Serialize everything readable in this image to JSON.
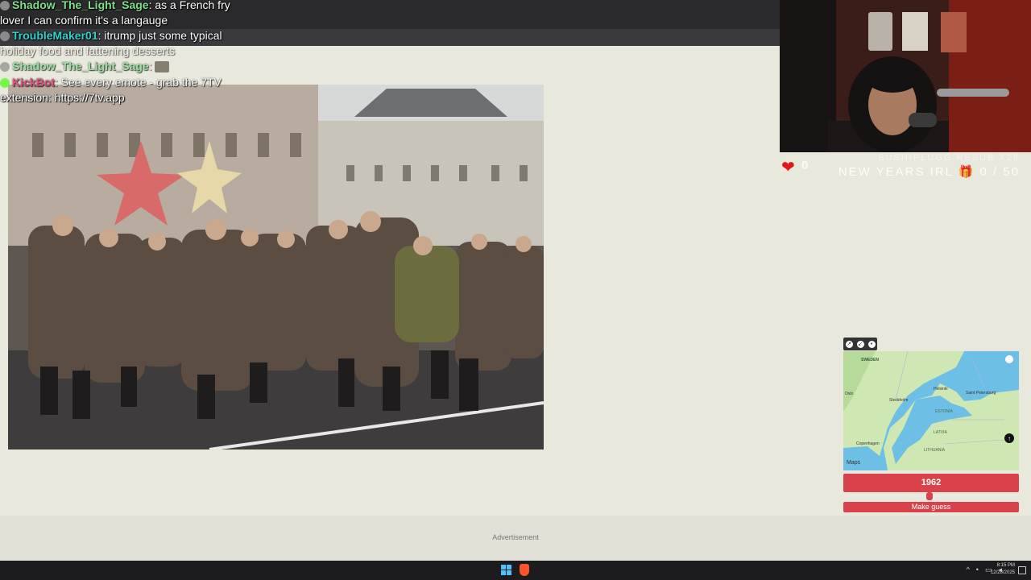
{
  "chat": [
    {
      "name": "Shadow_The_Light_Sage",
      "name_color": "#7ee08a",
      "message": ": as a French fry"
    },
    {
      "name": "",
      "name_color": "#fff",
      "message": "lover I can confirm it's a langauge"
    },
    {
      "name": "TroubleMaker01",
      "name_color": "#2fd0d0",
      "message": ": itrump just some typical"
    },
    {
      "name": "",
      "name_color": "#fff",
      "message": "holiday food and fattening desserts"
    },
    {
      "name": "Shadow_The_Light_Sage",
      "name_color": "#7ee08a",
      "message": ":"
    },
    {
      "name": "KickBot",
      "name_color": "#e0245e",
      "message": ": See every emote - grab the 7TV"
    },
    {
      "name": "",
      "name_color": "#fff",
      "message": "extension: https://7tv.app"
    }
  ],
  "stream_overlay": {
    "heart_count": "0",
    "sub_line": "SUSHIPLUGG RESUB X28",
    "goal_label": "NEW YEARS IRL",
    "goal_progress": "0 / 50"
  },
  "map": {
    "labels": {
      "sweden": "SWEDEN",
      "helsinki": "Helsinki",
      "saint_petersburg": "Saint Petersburg",
      "oslo": "Oslo",
      "stockholm": "Stockholm",
      "estonia": "ESTONIA",
      "latvia": "LATVIA",
      "copenhagen": "Copenhagen",
      "lithuania": "LITHUANIA",
      "attribution": "Maps"
    },
    "controls": [
      "expand",
      "shrink",
      "pin"
    ]
  },
  "guess": {
    "year": "1962",
    "year_fraction": 0.49,
    "button_label": "Make guess"
  },
  "ad": {
    "label": "Advertisement"
  },
  "taskbar": {
    "time": "8:15 PM",
    "date": "12/28/2025"
  },
  "colors": {
    "accent": "#d9424a",
    "page_bg": "#e9e8dc",
    "taskbar": "#1c1c1e"
  }
}
